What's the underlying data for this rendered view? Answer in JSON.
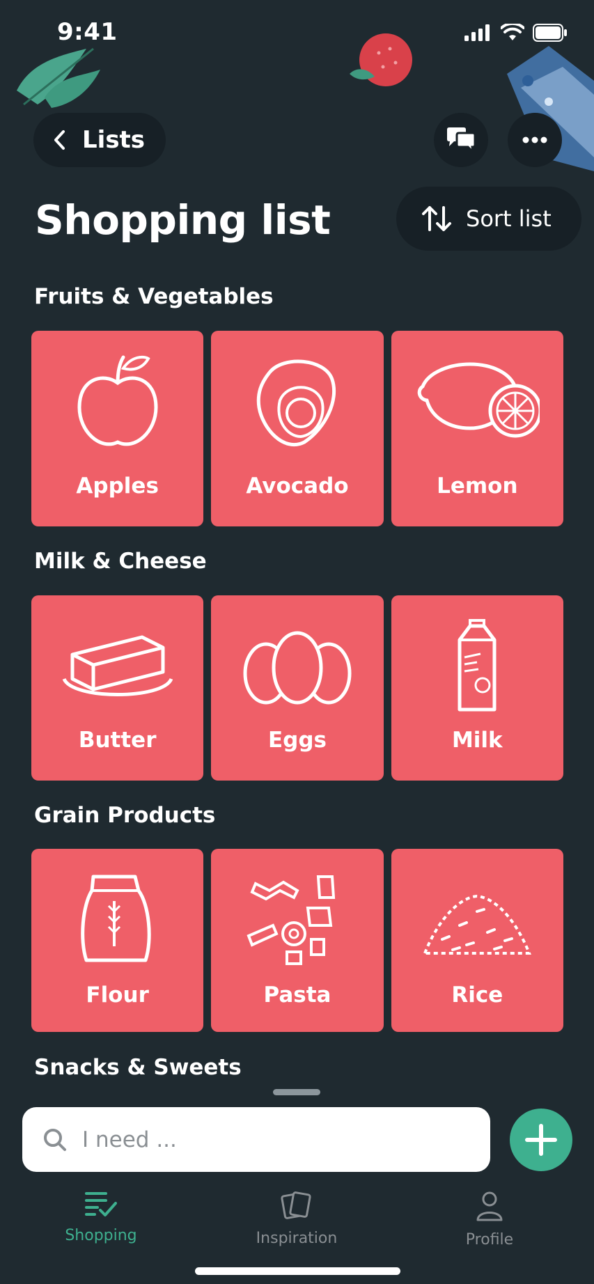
{
  "status": {
    "time": "9:41"
  },
  "nav": {
    "back_label": "Lists"
  },
  "header": {
    "title": "Shopping list",
    "sort_label": "Sort list"
  },
  "sections": [
    {
      "title": "Fruits & Vegetables",
      "items": [
        {
          "label": "Apples",
          "icon": "apple-icon"
        },
        {
          "label": "Avocado",
          "icon": "avocado-icon"
        },
        {
          "label": "Lemon",
          "icon": "lemon-icon"
        }
      ]
    },
    {
      "title": "Milk & Cheese",
      "items": [
        {
          "label": "Butter",
          "icon": "butter-icon"
        },
        {
          "label": "Eggs",
          "icon": "eggs-icon"
        },
        {
          "label": "Milk",
          "icon": "milk-carton-icon"
        }
      ]
    },
    {
      "title": "Grain Products",
      "items": [
        {
          "label": "Flour",
          "icon": "flour-bag-icon"
        },
        {
          "label": "Pasta",
          "icon": "pasta-icon"
        },
        {
          "label": "Rice",
          "icon": "rice-icon"
        }
      ]
    },
    {
      "title": "Snacks & Sweets",
      "items": []
    }
  ],
  "search": {
    "placeholder": "I need ..."
  },
  "tabs": [
    {
      "label": "Shopping",
      "icon": "list-check-icon",
      "active": true
    },
    {
      "label": "Inspiration",
      "icon": "cards-icon",
      "active": false
    },
    {
      "label": "Profile",
      "icon": "person-icon",
      "active": false
    }
  ],
  "colors": {
    "background": "#1f2a30",
    "tile": "#ef5f68",
    "accent": "#3eb08f",
    "button_bg": "#172026"
  }
}
